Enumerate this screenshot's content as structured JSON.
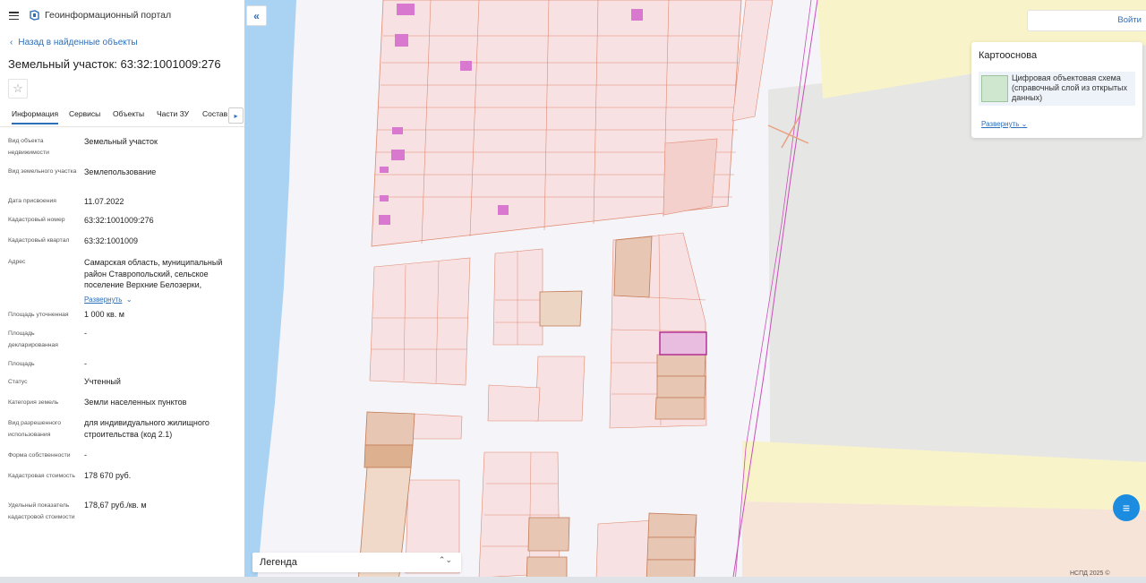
{
  "header": {
    "portal_title": "Геоинформационный портал"
  },
  "nav": {
    "back_label": "Назад в найденные объекты"
  },
  "object": {
    "title": "Земельный участок: 63:32:1001009:276"
  },
  "tabs": [
    {
      "label": "Информация",
      "active": true
    },
    {
      "label": "Сервисы"
    },
    {
      "label": "Объекты"
    },
    {
      "label": "Части ЗУ"
    },
    {
      "label": "Состав"
    }
  ],
  "properties": [
    {
      "label": "Вид объекта недвижимости",
      "value": "Земельный участок"
    },
    {
      "label": "Вид земельного участка",
      "value": "Землепользование"
    },
    {
      "label": "Дата присвоения",
      "value": "11.07.2022"
    },
    {
      "label": "Кадастровый номер",
      "value": "63:32:1001009:276"
    },
    {
      "label": "Кадастровый квартал",
      "value": "63:32:1001009"
    },
    {
      "label": "Адрес",
      "value": "Самарская область, муниципальный район Ставропольский, сельское поселение Верхние Белозерки,"
    },
    {
      "label": "Площадь уточненная",
      "value": "1 000 кв. м"
    },
    {
      "label": "Площадь декларированная",
      "value": "-"
    },
    {
      "label": "Площадь",
      "value": "-"
    },
    {
      "label": "Статус",
      "value": "Учтенный"
    },
    {
      "label": "Категория земель",
      "value": "Земли населенных пунктов"
    },
    {
      "label": "Вид разрешенного использования",
      "value": "для индивидуального жилищного строительства (код 2.1)"
    },
    {
      "label": "Форма собственности",
      "value": "-"
    },
    {
      "label": "Кадастровая стоимость",
      "value": "178 670 руб."
    },
    {
      "label": "Удельный показатель кадастровой стоимости",
      "value": "178,67 руб./кв. м"
    }
  ],
  "address_expand_label": "Развернуть",
  "map": {
    "login_label": "Войти",
    "basemap_title": "Картооснова",
    "basemap_layer": "Цифровая объектовая схема (справочный слой из открытых данных)",
    "basemap_expand": "Развернуть",
    "legend_label": "Легенда",
    "copyright": "НСПД 2025 ©"
  },
  "colors": {
    "accent": "#2d6fb9",
    "parcel_fill": "#f8e1e2",
    "parcel_border": "#e08a70",
    "selected_parcel": "#e8bde0",
    "yellow_zone": "#f9f3c9",
    "grey_zone": "#e6e6e4"
  }
}
